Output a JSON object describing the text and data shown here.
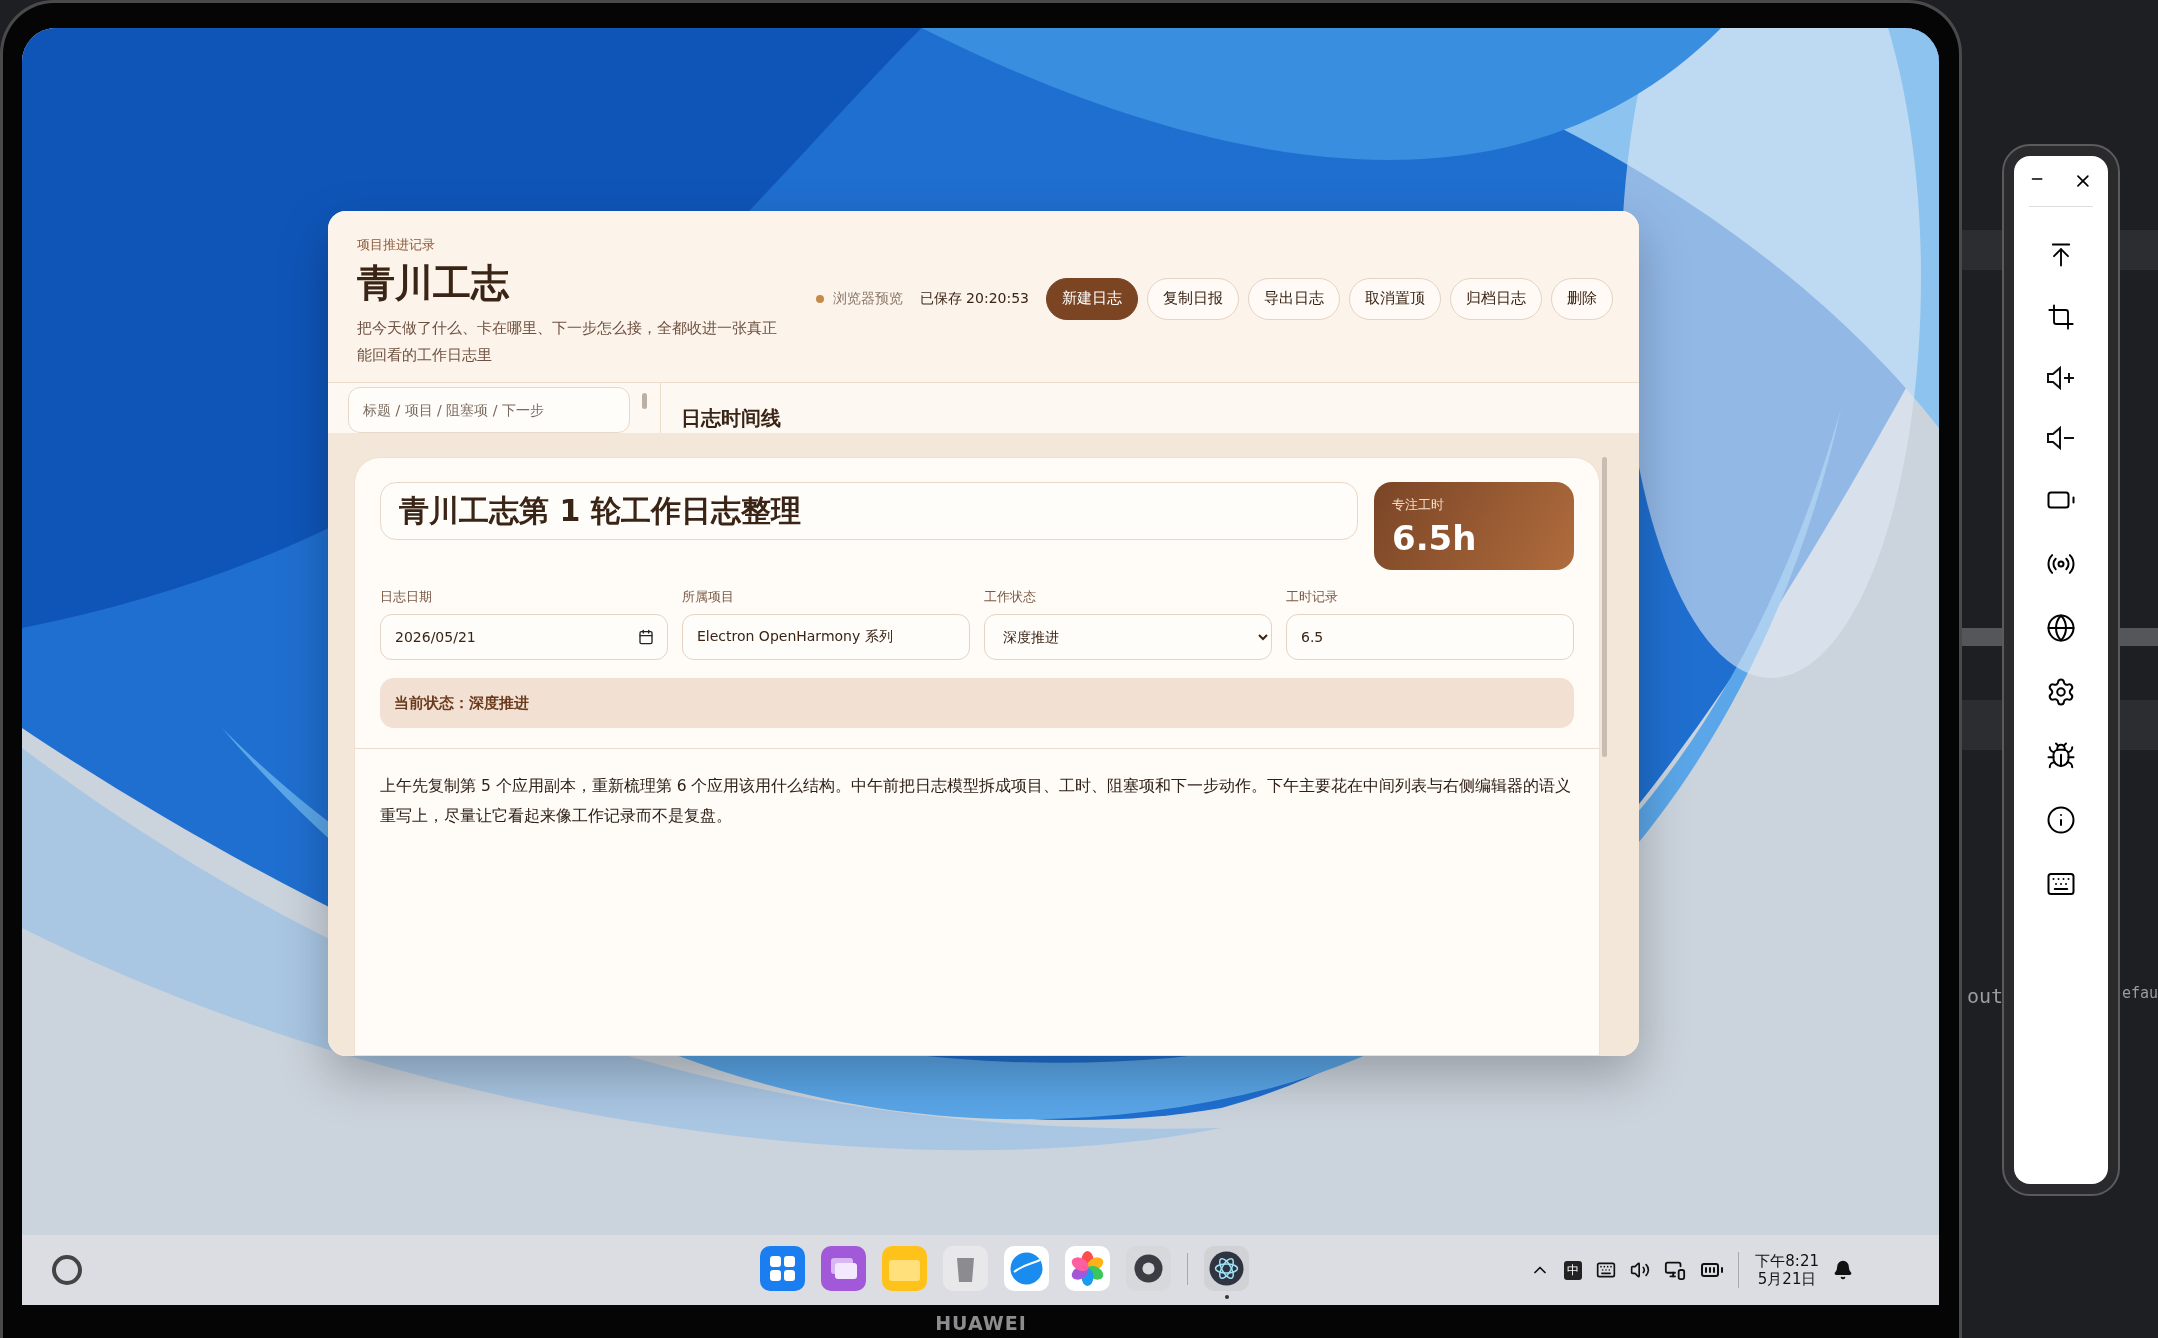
{
  "device": {
    "brand": "HUAWEI"
  },
  "window": {
    "eyebrow": "项目推进记录",
    "title": "青川工志",
    "subtitle": "把今天做了什么、卡在哪里、下一步怎么接，全都收进一张真正能回看的工作日志里",
    "status": {
      "label": "浏览器预览",
      "color": "#c8884a"
    },
    "saved": "已保存 20:20:53",
    "buttons": [
      {
        "label": "新建日志",
        "primary": true
      },
      {
        "label": "复制日报",
        "primary": false
      },
      {
        "label": "导出日志",
        "primary": false
      },
      {
        "label": "取消置顶",
        "primary": false
      },
      {
        "label": "归档日志",
        "primary": false
      },
      {
        "label": "删除",
        "primary": false
      }
    ]
  },
  "sidebar": {
    "search": {
      "placeholder": "标题 / 项目 / 阻塞项 / 下一步"
    }
  },
  "timeline": {
    "title": "日志时间线"
  },
  "editor": {
    "title": "青川工志第 1 轮工作日志整理",
    "hours": {
      "label": "专注工时",
      "value": "6.5h"
    },
    "fields": [
      {
        "label": "日志日期",
        "kind": "date",
        "value": "2026/05/21"
      },
      {
        "label": "所属项目",
        "kind": "text",
        "value": "Electron OpenHarmony 系列"
      },
      {
        "label": "工作状态",
        "kind": "select",
        "value": "深度推进"
      },
      {
        "label": "工时记录",
        "kind": "text",
        "value": "6.5"
      }
    ],
    "status_note": "当前状态：深度推进",
    "body": "上午先复制第 5 个应用副本，重新梳理第 6 个应用该用什么结构。中午前把日志模型拆成项目、工时、阻塞项和下一步动作。下午主要花在中间列表与右侧编辑器的语义重写上，尽量让它看起来像工作记录而不是复盘。"
  },
  "taskbar": {
    "apps": [
      {
        "kind": "launcher",
        "running": false
      },
      {
        "kind": "multiwindow",
        "running": false
      },
      {
        "kind": "files",
        "running": false
      },
      {
        "kind": "trash",
        "running": false
      },
      {
        "kind": "browser",
        "running": false
      },
      {
        "kind": "photos",
        "running": false
      },
      {
        "kind": "settings",
        "running": false
      },
      {
        "kind": "electron",
        "running": true
      }
    ],
    "ime": "中",
    "time": "下午8:21",
    "date": "5月21日"
  },
  "background_code": {
    "texts": [
      "out",
      "efau"
    ]
  }
}
